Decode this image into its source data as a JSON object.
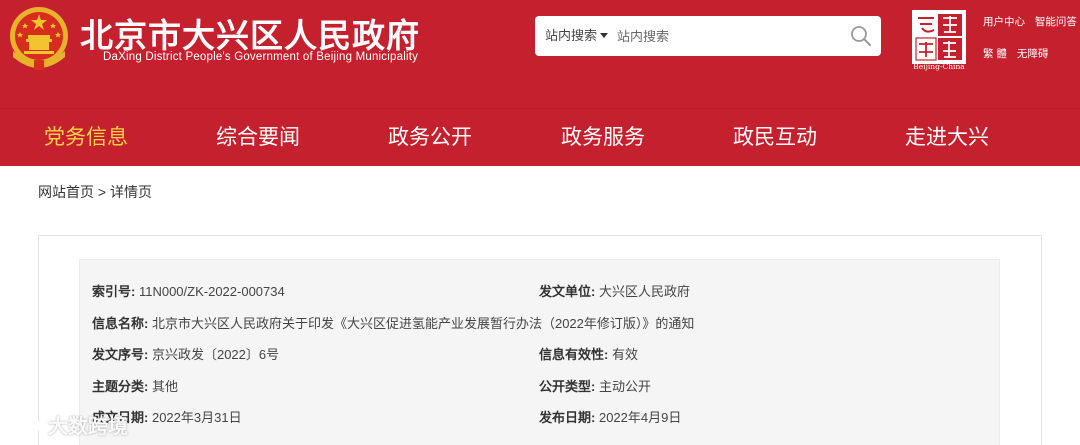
{
  "header": {
    "title_cn": "北京市大兴区人民政府",
    "title_en": "DaXing District People's Government of Beijing Municipality",
    "search": {
      "scope": "站内搜索",
      "placeholder": "站内搜索"
    },
    "capital_logo_label": "Beijing-China",
    "links_row1": [
      "用户中心",
      "智能问答"
    ],
    "links_row2": [
      "繁 體",
      "无障碍"
    ]
  },
  "nav": [
    {
      "label": "党务信息",
      "active": true
    },
    {
      "label": "综合要闻",
      "active": false
    },
    {
      "label": "政务公开",
      "active": false
    },
    {
      "label": "政务服务",
      "active": false
    },
    {
      "label": "政民互动",
      "active": false
    },
    {
      "label": "走进大兴",
      "active": false
    }
  ],
  "breadcrumb": {
    "home": "网站首页",
    "separator": ">",
    "current": "详情页"
  },
  "meta": {
    "index_no": {
      "label": "索引号:",
      "value": "11N000/ZK-2022-000734"
    },
    "issuer": {
      "label": "发文单位:",
      "value": "大兴区人民政府"
    },
    "info_name": {
      "label": "信息名称:",
      "value": "北京市大兴区人民政府关于印发《大兴区促进氢能产业发展暂行办法（2022年修订版）》的通知"
    },
    "doc_no": {
      "label": "发文序号:",
      "value": "京兴政发〔2022〕6号"
    },
    "validity": {
      "label": "信息有效性:",
      "value": "有效"
    },
    "topic": {
      "label": "主题分类:",
      "value": "其他"
    },
    "open_type": {
      "label": "公开类型:",
      "value": "主动公开"
    },
    "created": {
      "label": "成文日期:",
      "value": "2022年3月31日"
    },
    "published": {
      "label": "发布日期:",
      "value": "2022年4月9日"
    }
  },
  "watermark": "大数跨境",
  "colors": {
    "brand_red": "#c4202e",
    "nav_active": "#ffd24a"
  }
}
